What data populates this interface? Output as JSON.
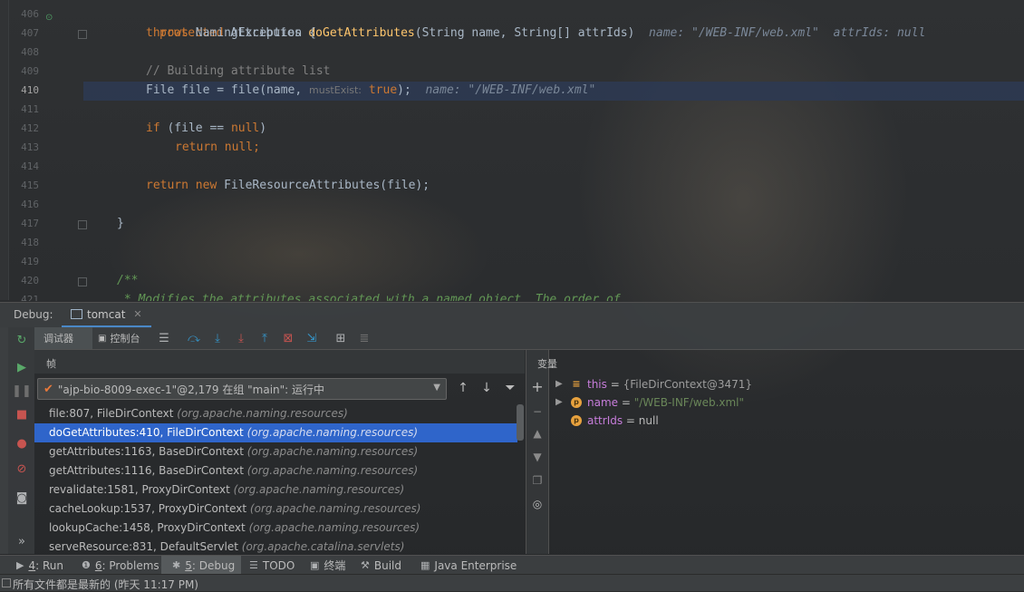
{
  "editor": {
    "lines": [
      {
        "num": "406",
        "current": false
      },
      {
        "num": "407",
        "current": false
      },
      {
        "num": "408",
        "current": false
      },
      {
        "num": "409",
        "current": false
      },
      {
        "num": "410",
        "current": true
      },
      {
        "num": "411",
        "current": false
      },
      {
        "num": "412",
        "current": false
      },
      {
        "num": "413",
        "current": false
      },
      {
        "num": "414",
        "current": false
      },
      {
        "num": "415",
        "current": false
      },
      {
        "num": "416",
        "current": false
      },
      {
        "num": "417",
        "current": false
      },
      {
        "num": "418",
        "current": false
      },
      {
        "num": "419",
        "current": false
      },
      {
        "num": "420",
        "current": false
      },
      {
        "num": "421",
        "current": false
      }
    ],
    "code": {
      "l406_kw": "protected",
      "l406_type": " Attributes ",
      "l406_fn": "doGetAttributes",
      "l406_params": "(String name, String[] attrIds)",
      "l406_hint1": "  name: \"/WEB-INF/web.xml\"",
      "l406_hint2": "  attrIds: null",
      "l407_kw": "throws",
      "l407_rest": " NamingException {",
      "l409_comment": "// Building attribute list",
      "l410_code": "File file = file(name, ",
      "l410_param_hint": "mustExist:",
      "l410_kw": " true",
      "l410_end": ");",
      "l410_inline": "  name: \"/WEB-INF/web.xml\"",
      "l412_kw": "if",
      "l412_mid": " (file == ",
      "l412_kw2": "null",
      "l412_end": ")",
      "l413_kw": "return",
      "l413_kw2": " null",
      "l413_end": ";",
      "l415_kw": "return",
      "l415_kw2": " new",
      "l415_rest": " FileResourceAttributes(file);",
      "l417_brace": "}",
      "l420_doc": "/**",
      "l421_doc": " * Modifies the attributes associated with a named object. The order of"
    }
  },
  "debug": {
    "title": "Debug:",
    "session_tab": "tomcat",
    "tabs": {
      "debugger": "调试器",
      "console": "控制台"
    },
    "frames_label": "帧",
    "variables_label": "变量",
    "thread": "\"ajp-bio-8009-exec-1\"@2,179 在组 \"main\": 运行中",
    "frames": [
      {
        "method": "file:807, FileDirContext ",
        "pkg": "(org.apache.naming.resources)",
        "selected": false
      },
      {
        "method": "doGetAttributes:410, FileDirContext ",
        "pkg": "(org.apache.naming.resources)",
        "selected": true
      },
      {
        "method": "getAttributes:1163, BaseDirContext ",
        "pkg": "(org.apache.naming.resources)",
        "selected": false
      },
      {
        "method": "getAttributes:1116, BaseDirContext ",
        "pkg": "(org.apache.naming.resources)",
        "selected": false
      },
      {
        "method": "revalidate:1581, ProxyDirContext ",
        "pkg": "(org.apache.naming.resources)",
        "selected": false
      },
      {
        "method": "cacheLookup:1537, ProxyDirContext ",
        "pkg": "(org.apache.naming.resources)",
        "selected": false
      },
      {
        "method": "lookupCache:1458, ProxyDirContext ",
        "pkg": "(org.apache.naming.resources)",
        "selected": false
      },
      {
        "method": "serveResource:831, DefaultServlet ",
        "pkg": "(org.apache.catalina.servlets)",
        "selected": false
      }
    ],
    "variables": [
      {
        "name": "this",
        "eq": " = ",
        "value": "{FileDirContext@3471}",
        "kind": "object",
        "icon": "fields-icon",
        "expandable": true
      },
      {
        "name": "name",
        "eq": " = ",
        "value": "\"/WEB-INF/web.xml\"",
        "kind": "string",
        "icon": "p-icon",
        "expandable": true
      },
      {
        "name": "attrIds",
        "eq": " = ",
        "value": "null",
        "kind": "plain",
        "icon": "p-icon",
        "expandable": false
      }
    ],
    "icon_letter": "p"
  },
  "bottom_tabs": [
    {
      "num": "4",
      "label": ": Run",
      "icon": "run-icon",
      "active": false
    },
    {
      "num": "6",
      "label": ": Problems",
      "icon": "problems-icon",
      "active": false
    },
    {
      "num": "5",
      "label": ": Debug",
      "icon": "debug-icon",
      "active": true
    },
    {
      "num": "",
      "label": "TODO",
      "icon": "todo-icon",
      "active": false
    },
    {
      "num": "",
      "label": "终端",
      "icon": "terminal-icon",
      "active": false
    },
    {
      "num": "",
      "label": "Build",
      "icon": "build-icon",
      "active": false
    },
    {
      "num": "",
      "label": "Java Enterprise",
      "icon": "java-enterprise-icon",
      "active": false
    }
  ],
  "status": {
    "text": "所有文件都是最新的 (昨天 11:17 PM)"
  },
  "colors": {
    "selection": "#2f65ca",
    "keyword": "#cc7832",
    "string": "#6a8759",
    "accent": "#4a88c7"
  }
}
